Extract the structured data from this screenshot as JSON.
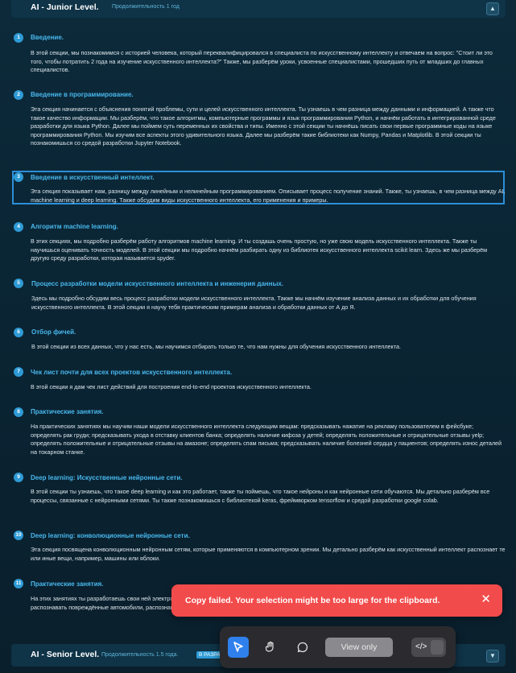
{
  "junior": {
    "title": "AI - Junior Level.",
    "subtitle": "Продолжительность 1 год"
  },
  "senior": {
    "title": "AI - Senior Level.",
    "subtitle": "Продолжительность 1.5 года.",
    "badge": "В РАЗРА"
  },
  "sections": [
    {
      "num": "1",
      "title": "Введение.",
      "body": "В этой секции, мы познакомимся с историей человека, который переквалифицировался в специалиста по искусственному интеллекту и отвечаем на вопрос: \"Стоит ли это того, чтобы потратить 2 года на изучение искусственного интеллекта?\" Также, мы разберём уроки, усвоенные специалистами, прошедших путь от младших до главных специалистов."
    },
    {
      "num": "2",
      "title": "Введение в программирование.",
      "body": "Эта секция начинается с объяснения понятий проблемы, сути и целей искусственного интеллекта. Ты узнаешь в чем разница между данными и информацией. А также что такое качество информации. Мы разберём, что такое алгоритмы, компьютерные программы и язык программирования Python, и начнём работать в интегрированной среде разработки для языка Python. Далее мы поймем суть переменных их свойства и типы. Именно с этой секции ты начнёшь писать свои первые программные коды на языке программирования Python. Мы изучим все аспекты этого удивительного языка.  Далее мы разберём такие библиотеки как Numpy, Pandas и Matplotlib. В этой секции ты познакомишься со средой разработки Jupyter Notebook."
    },
    {
      "num": "3",
      "title": "Введение в искусственный интеллект.",
      "body": "Эта секция показывает нам, разницу между линейным и нелинейным программированием. Описывает процесс получение знаний. Также, ты узнаешь, в чем разница между AI, machine learning и deep learning. Также обсудим виды искусственного интеллекта, его применения и примеры."
    },
    {
      "num": "4",
      "title": "Алгоритм machine learning.",
      "body": "В этих секциях, мы подробно разберём работу алгоритмов machine learning. И ты создашь очень простую, но уже свою модель искусственного интеллекта. Также ты научишься оценивать точность моделей. В этой секции мы подробно начнём разбирать одну из библиотек искусственного интеллекта scikit learn. Здесь же мы разберём другую среду разработки, которая называется spyder."
    },
    {
      "num": "5",
      "title": "Процесс разработки модели искусственного интеллекта и инженерия данных.",
      "body": "Здесь мы подробно обсудим весь процесс разработки модели искусственного интеллекта. Также мы начнём изучение анализа данных и их обработки для обучения искусственного интеллекта. В этой секции я научу тебя практическим примерам анализа и обработки данных от А до Я."
    },
    {
      "num": "6",
      "title": "Отбор фичей.",
      "body": "В этой секции из всех данных, что у нас есть, мы научимся отбирать только те, что нам нужны для обучения искусственного интеллекта."
    },
    {
      "num": "7",
      "title": "Чек лист почти для всех проектов искусственного интеллекта.",
      "body": "В этой секции я дам чек лист действий для построения end-to-end проектов искусственного интеллекта."
    },
    {
      "num": "8",
      "title": "Практические занятия.",
      "body": "На практических занятиях мы научим наши модели искусственного интеллекта следующим вещам: предсказывать нажатие на рекламу пользователем в фейсбуке; определять рак груди; предсказывать ухода в отставку клиентов банка; определять наличие кифоза у детей; определять положительные и отрицательные отзывы yelp; определять положительные и отрицательные отзывы на амазоне; определять спам письма; предсказывать наличие болезней сердца у пациентов; определять износ деталей на токарном станке."
    },
    {
      "num": "9",
      "title": "Deep learning: Искусственные нейронные сети.",
      "body": "В этой секции ты узнаешь, что такое deep learning и как это работает, также ты поймешь, что такое нейроны и как нейронные сети обучаются. Мы детально разберём все процессы, связанные с нейронными сетями. Ты также познакомишься с библиотекой keras, фреймворком tensorflow и средой разработки google colab."
    },
    {
      "num": "10",
      "title": "Deep learning: конволюционные нейронные сети.",
      "body": "Эта секция посвящена конволюционным нейронным сетям, которые применяются в компьютерном зрении. Мы детально разберём как искусственный интеллект распознает те или иные вещи, например, машины или яблоки."
    },
    {
      "num": "11",
      "title": "Практические занятия.",
      "body": "На этих занятиях ты разработаешь свои ней электростанций (кейс виртуальных сенсоров цифры, распознавать элементы одежды, распознавать различные объекты, распознавать повреждённые автомобили, распознавать уличные дорожные знаки для беспилотных автомобилей."
    }
  ],
  "toast": {
    "message": "Copy failed. Your selection might be too large for the clipboard."
  },
  "toolbar": {
    "view_only": "View only"
  }
}
